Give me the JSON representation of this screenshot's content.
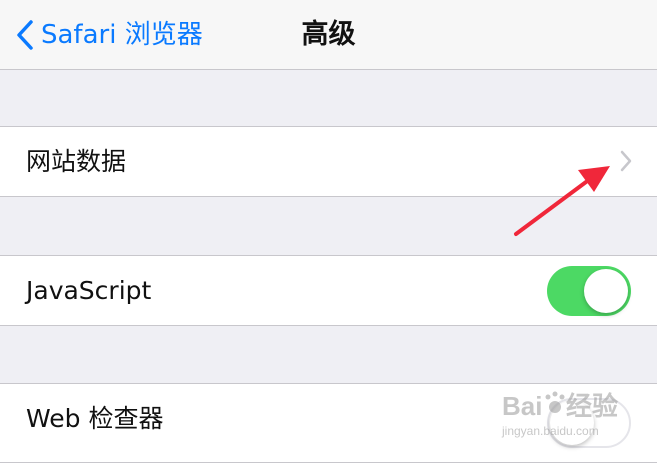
{
  "navbar": {
    "back_label": "Safari 浏览器",
    "title": "高级",
    "back_icon": "chevron-left-icon"
  },
  "rows": {
    "website_data": {
      "label": "网站数据",
      "accessory_icon": "chevron-right-icon"
    },
    "javascript": {
      "label": "JavaScript",
      "toggle_on": true
    },
    "web_inspector": {
      "label": "Web 检查器",
      "toggle_on": false
    }
  },
  "watermark": {
    "brand": "Baidu",
    "sub": "经验",
    "url": "jingyan.baidu.com"
  },
  "colors": {
    "accent": "#0a7aff",
    "toggle_on": "#4cd964",
    "annotation_arrow": "#f0273a"
  }
}
